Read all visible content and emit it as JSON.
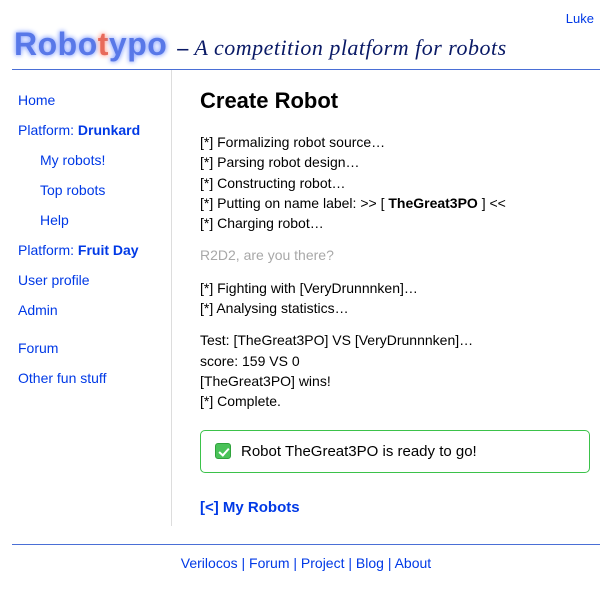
{
  "topbar": {
    "user": "Luke"
  },
  "header": {
    "logo_part1": "Robo",
    "logo_part2": "t",
    "logo_part3": "ypo",
    "dash": "–",
    "tagline": "A competition platform for robots"
  },
  "sidebar": {
    "home": "Home",
    "platform_prefix": "Platform:",
    "platform1": "Drunkard",
    "my_robots": "My robots!",
    "top_robots": "Top robots",
    "help": "Help",
    "platform2": "Fruit Day",
    "user_profile": "User profile",
    "admin": "Admin",
    "forum": "Forum",
    "other": "Other fun stuff"
  },
  "main": {
    "title": "Create Robot",
    "log": {
      "0": "[*] Formalizing robot source…",
      "1": "[*] Parsing robot design…",
      "2": "[*] Constructing robot…",
      "4": "[*] Charging robot…",
      "5": "[*] Fighting with [VeryDrunnnken]…",
      "6": "[*] Analysing statistics…",
      "7": "Test: [TheGreat3PO] VS [VeryDrunnnken]…",
      "8": "score: 159 VS 0",
      "9": "[TheGreat3PO] wins!",
      "10": "[*] Complete."
    },
    "log3_pre": "[*] Putting on name label: >> [ ",
    "log3_name": "TheGreat3PO",
    "log3_post": " ] <<",
    "easter": "R2D2, are you there?",
    "success": {
      "pre": "Robot",
      "name": "TheGreat3PO",
      "post": "is ready to go!"
    },
    "back": {
      "icon": "[<]",
      "label": "My Robots"
    }
  },
  "footer": {
    "0": "Verilocos",
    "1": "Forum",
    "2": "Project",
    "3": "Blog",
    "4": "About"
  }
}
